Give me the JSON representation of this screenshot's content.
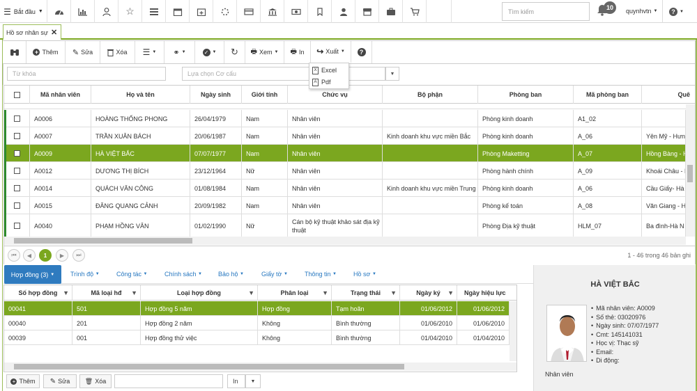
{
  "topbar": {
    "start_label": "Bắt đầu",
    "search_placeholder": "Tìm kiếm",
    "notifications": "10",
    "user": "quynhvtn"
  },
  "tabs": [
    {
      "label": "Hồ sơ nhân sự"
    }
  ],
  "toolbar": {
    "add": "Thêm",
    "edit": "Sửa",
    "delete": "Xóa",
    "view": "Xem",
    "print": "In",
    "export": "Xuất"
  },
  "export_menu": [
    {
      "label": "Excel"
    },
    {
      "label": "Pdf"
    }
  ],
  "filters": {
    "keyword_placeholder": "Từ khóa",
    "structure_placeholder": "Lựa chọn Cơ cấu"
  },
  "employees": {
    "columns": [
      "Mã nhân viên",
      "Họ và tên",
      "Ngày sinh",
      "Giới tính",
      "Chức vụ",
      "Bộ phận",
      "Phòng ban",
      "Mã phòng ban",
      "Quê"
    ],
    "rows": [
      {
        "code": "A0006",
        "name": "HOÀNG THỐNG PHONG",
        "dob": "26/04/1979",
        "gender": "Nam",
        "position": "Nhân viên",
        "division": "",
        "department": "Phòng kinh doanh",
        "dept_code": "A1_02",
        "hometown": ""
      },
      {
        "code": "A0007",
        "name": "TRẦN XUÂN BÁCH",
        "dob": "20/06/1987",
        "gender": "Nam",
        "position": "Nhân viên",
        "division": "Kinh doanh khu vực miền Bắc",
        "department": "Phòng kinh doanh",
        "dept_code": "A_06",
        "hometown": "Yên Mỹ - Hưng"
      },
      {
        "code": "A0009",
        "name": "HÀ VIỆT BẮC",
        "dob": "07/07/1977",
        "gender": "Nam",
        "position": "Nhân viên",
        "division": "",
        "department": "Phòng Maketting",
        "dept_code": "A_07",
        "hometown": "Hồng Bàng - H"
      },
      {
        "code": "A0012",
        "name": "DƯƠNG THỊ BÍCH",
        "dob": "23/12/1964",
        "gender": "Nữ",
        "position": "Nhân viên",
        "division": "",
        "department": "Phòng hành chính",
        "dept_code": "A_09",
        "hometown": "Khoái Châu - H"
      },
      {
        "code": "A0014",
        "name": "QUÁCH VĂN CÔNG",
        "dob": "01/08/1984",
        "gender": "Nam",
        "position": "Nhân viên",
        "division": "Kinh doanh khu vực miền Trung",
        "department": "Phòng kinh doanh",
        "dept_code": "A_06",
        "hometown": "Cầu Giấy- Hà N"
      },
      {
        "code": "A0015",
        "name": "ĐĂNG QUANG CẢNH",
        "dob": "20/09/1982",
        "gender": "Nam",
        "position": "Nhân viên",
        "division": "",
        "department": "Phòng kế toán",
        "dept_code": "A_08",
        "hometown": "Văn Giang - H"
      },
      {
        "code": "A0040",
        "name": "PHẠM HỒNG VÂN",
        "dob": "01/02/1990",
        "gender": "Nữ",
        "position": "Cán bộ kỹ thuật khảo sát địa kỹ thuật",
        "division": "",
        "department": "Phòng Địa kỹ thuật",
        "dept_code": "HLM_07",
        "hometown": "Ba đình-Hà N"
      }
    ]
  },
  "pager": {
    "page": "1",
    "summary": "1 - 46 trong 46 bản ghi"
  },
  "subtabs": [
    "Hợp đồng (3)",
    "Trình độ",
    "Công tác",
    "Chính sách",
    "Bảo hộ",
    "Giấy tờ",
    "Thông tin",
    "Hồ sơ"
  ],
  "contracts": {
    "columns": [
      "Số hợp đồng",
      "Mã loại hđ",
      "Loại hợp đồng",
      "Phân loại",
      "Trạng thái",
      "Ngày ký",
      "Ngày hiệu lực"
    ],
    "rows": [
      {
        "no": "00041",
        "type_code": "501",
        "type": "Hợp đồng 5 năm",
        "category": "Hợp đồng",
        "status": "Tạm hoãn",
        "signed": "01/06/2012",
        "effective": "01/06/2012"
      },
      {
        "no": "00040",
        "type_code": "201",
        "type": "Hợp đồng 2 năm",
        "category": "Không",
        "status": "Bình thường",
        "signed": "01/06/2010",
        "effective": "01/06/2010"
      },
      {
        "no": "00039",
        "type_code": "001",
        "type": "Hợp đồng thử việc",
        "category": "Không",
        "status": "Bình thường",
        "signed": "01/04/2010",
        "effective": "01/04/2010"
      }
    ]
  },
  "bottom_toolbar": {
    "add": "Thêm",
    "edit": "Sửa",
    "delete": "Xóa",
    "print": "In"
  },
  "profile": {
    "name": "HÀ VIỆT BẮC",
    "details": [
      "Mã nhân viên: A0009",
      "Số thẻ: 03020976",
      "Ngày sinh: 07/07/1977",
      "Cmt: 145141031",
      "Học vị: Thạc sỹ",
      "Email:",
      "Di động:"
    ],
    "role": "Nhân viên"
  },
  "colors": {
    "accent": "#7ba71f",
    "tab_blue": "#2f7bbf",
    "link": "#2677c0"
  }
}
